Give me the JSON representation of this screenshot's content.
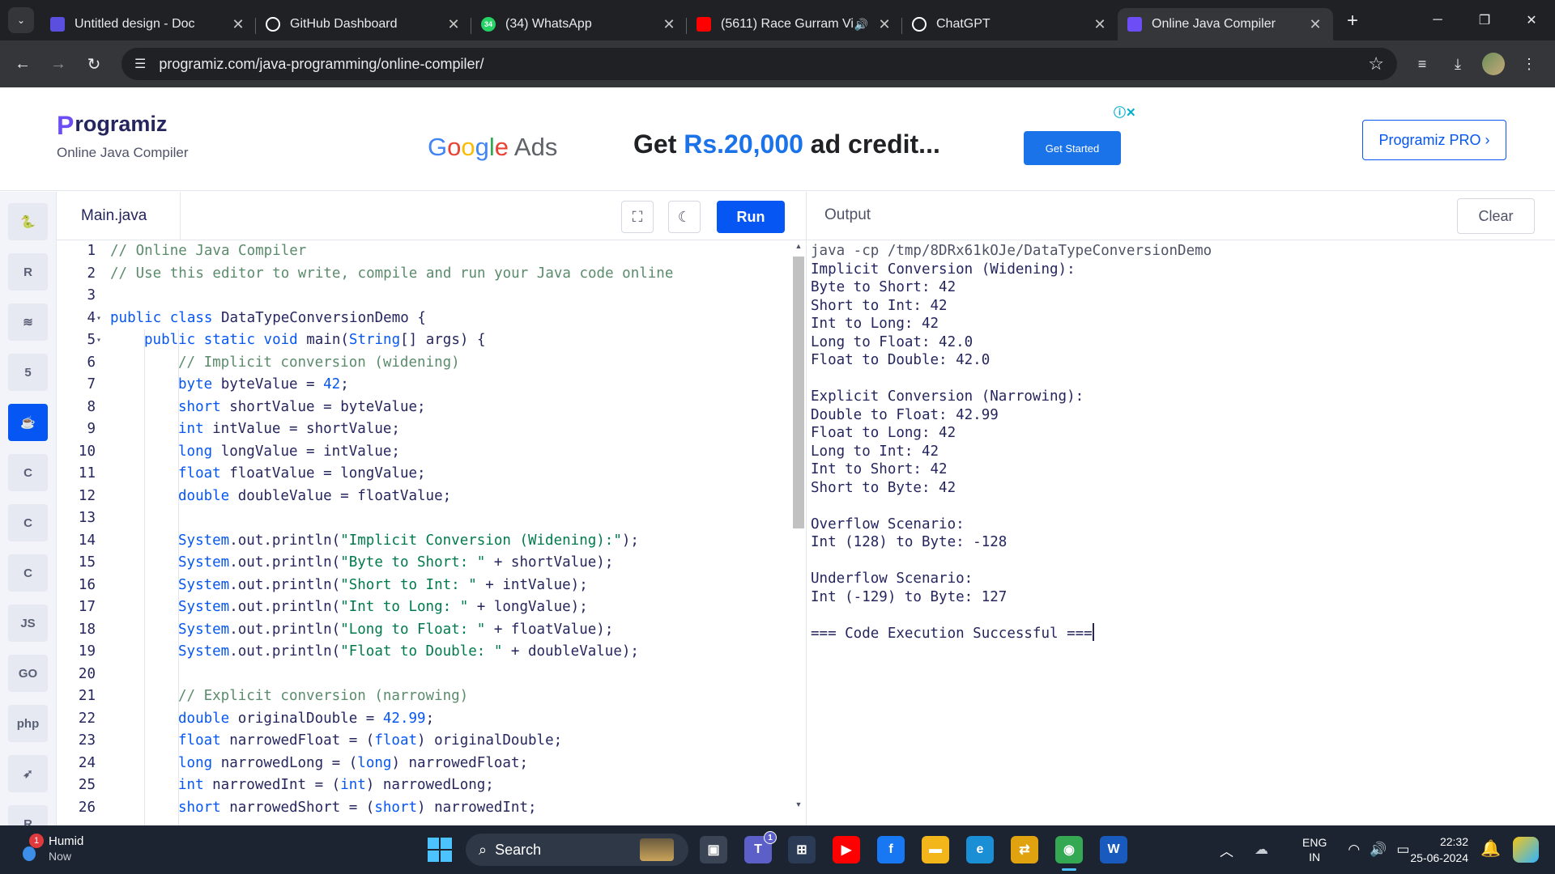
{
  "browser": {
    "tabs": [
      {
        "title": "Untitled design - Doc",
        "icon": "canva-docs-icon",
        "color": "#5b4fe0"
      },
      {
        "title": "GitHub Dashboard",
        "icon": "github-icon",
        "color": "#ffffff"
      },
      {
        "title": "(34) WhatsApp",
        "icon": "whatsapp-icon",
        "color": "#25d366",
        "badge": "34"
      },
      {
        "title": "(5611) Race Gurram Vi",
        "icon": "youtube-icon",
        "color": "#ff0000",
        "audio": true
      },
      {
        "title": "ChatGPT",
        "icon": "chatgpt-icon",
        "color": "#ffffff"
      },
      {
        "title": "Online Java Compiler",
        "icon": "programiz-icon",
        "color": "#6c4df6",
        "active": true
      }
    ],
    "url": "programiz.com/java-programming/online-compiler/"
  },
  "header": {
    "logo_text": "rogramiz",
    "logo_mark": "P",
    "subtitle": "Online Java Compiler",
    "pro_button": "Programiz PRO ›"
  },
  "ad": {
    "brand_google": [
      "G",
      "o",
      "o",
      "g",
      "l",
      "e"
    ],
    "brand_ads": " Ads",
    "headline_pre": "Get ",
    "headline_amount": "Rs.20,000",
    "headline_post": " ad credit...",
    "cta": "Get Started"
  },
  "sidebar": {
    "languages": [
      {
        "name": "python",
        "label": "🐍"
      },
      {
        "name": "r",
        "label": "R"
      },
      {
        "name": "sql",
        "label": "≋"
      },
      {
        "name": "html",
        "label": "5"
      },
      {
        "name": "java",
        "label": "☕",
        "active": true
      },
      {
        "name": "c",
        "label": "C"
      },
      {
        "name": "cpp",
        "label": "C"
      },
      {
        "name": "csharp",
        "label": "C"
      },
      {
        "name": "javascript",
        "label": "JS"
      },
      {
        "name": "go",
        "label": "GO"
      },
      {
        "name": "php",
        "label": "php"
      },
      {
        "name": "swift",
        "label": "➶"
      },
      {
        "name": "rust",
        "label": "R"
      }
    ]
  },
  "editor": {
    "filename": "Main.java",
    "run_label": "Run",
    "lines": [
      {
        "n": "1",
        "fold": "",
        "indent": 0,
        "tokens": [
          [
            "c",
            "// Online Java Compiler"
          ]
        ]
      },
      {
        "n": "2",
        "fold": "",
        "indent": 0,
        "tokens": [
          [
            "c",
            "// Use this editor to write, compile and run your Java code online"
          ]
        ]
      },
      {
        "n": "3",
        "fold": "",
        "indent": 0,
        "tokens": []
      },
      {
        "n": "4",
        "fold": "▾",
        "indent": 0,
        "tokens": [
          [
            "k",
            "public"
          ],
          [
            "t",
            " "
          ],
          [
            "k",
            "class"
          ],
          [
            "t",
            " DataTypeConversionDemo {"
          ]
        ]
      },
      {
        "n": "5",
        "fold": "▾",
        "indent": 1,
        "tokens": [
          [
            "k",
            "public"
          ],
          [
            "t",
            " "
          ],
          [
            "k",
            "static"
          ],
          [
            "t",
            " "
          ],
          [
            "k",
            "void"
          ],
          [
            "t",
            " main("
          ],
          [
            "k",
            "String"
          ],
          [
            "t",
            "[] args) {"
          ]
        ]
      },
      {
        "n": "6",
        "fold": "",
        "indent": 2,
        "tokens": [
          [
            "c",
            "// Implicit conversion (widening)"
          ]
        ]
      },
      {
        "n": "7",
        "fold": "",
        "indent": 2,
        "tokens": [
          [
            "k",
            "byte"
          ],
          [
            "t",
            " byteValue = "
          ],
          [
            "n",
            "42"
          ],
          [
            "t",
            ";"
          ]
        ]
      },
      {
        "n": "8",
        "fold": "",
        "indent": 2,
        "tokens": [
          [
            "k",
            "short"
          ],
          [
            "t",
            " shortValue = byteValue;"
          ]
        ]
      },
      {
        "n": "9",
        "fold": "",
        "indent": 2,
        "tokens": [
          [
            "k",
            "int"
          ],
          [
            "t",
            " intValue = shortValue;"
          ]
        ]
      },
      {
        "n": "10",
        "fold": "",
        "indent": 2,
        "tokens": [
          [
            "k",
            "long"
          ],
          [
            "t",
            " longValue = intValue;"
          ]
        ]
      },
      {
        "n": "11",
        "fold": "",
        "indent": 2,
        "tokens": [
          [
            "k",
            "float"
          ],
          [
            "t",
            " floatValue = longValue;"
          ]
        ]
      },
      {
        "n": "12",
        "fold": "",
        "indent": 2,
        "tokens": [
          [
            "k",
            "double"
          ],
          [
            "t",
            " doubleValue = floatValue;"
          ]
        ]
      },
      {
        "n": "13",
        "fold": "",
        "indent": 2,
        "tokens": []
      },
      {
        "n": "14",
        "fold": "",
        "indent": 2,
        "tokens": [
          [
            "k",
            "System"
          ],
          [
            "t",
            ".out.println("
          ],
          [
            "s",
            "\"Implicit Conversion (Widening):\""
          ],
          [
            "t",
            ");"
          ]
        ]
      },
      {
        "n": "15",
        "fold": "",
        "indent": 2,
        "tokens": [
          [
            "k",
            "System"
          ],
          [
            "t",
            ".out.println("
          ],
          [
            "s",
            "\"Byte to Short: \""
          ],
          [
            "t",
            " + shortValue);"
          ]
        ]
      },
      {
        "n": "16",
        "fold": "",
        "indent": 2,
        "tokens": [
          [
            "k",
            "System"
          ],
          [
            "t",
            ".out.println("
          ],
          [
            "s",
            "\"Short to Int: \""
          ],
          [
            "t",
            " + intValue);"
          ]
        ]
      },
      {
        "n": "17",
        "fold": "",
        "indent": 2,
        "tokens": [
          [
            "k",
            "System"
          ],
          [
            "t",
            ".out.println("
          ],
          [
            "s",
            "\"Int to Long: \""
          ],
          [
            "t",
            " + longValue);"
          ]
        ]
      },
      {
        "n": "18",
        "fold": "",
        "indent": 2,
        "tokens": [
          [
            "k",
            "System"
          ],
          [
            "t",
            ".out.println("
          ],
          [
            "s",
            "\"Long to Float: \""
          ],
          [
            "t",
            " + floatValue);"
          ]
        ]
      },
      {
        "n": "19",
        "fold": "",
        "indent": 2,
        "tokens": [
          [
            "k",
            "System"
          ],
          [
            "t",
            ".out.println("
          ],
          [
            "s",
            "\"Float to Double: \""
          ],
          [
            "t",
            " + doubleValue);"
          ]
        ]
      },
      {
        "n": "20",
        "fold": "",
        "indent": 2,
        "tokens": []
      },
      {
        "n": "21",
        "fold": "",
        "indent": 2,
        "tokens": [
          [
            "c",
            "// Explicit conversion (narrowing)"
          ]
        ]
      },
      {
        "n": "22",
        "fold": "",
        "indent": 2,
        "tokens": [
          [
            "k",
            "double"
          ],
          [
            "t",
            " originalDouble = "
          ],
          [
            "n",
            "42.99"
          ],
          [
            "t",
            ";"
          ]
        ]
      },
      {
        "n": "23",
        "fold": "",
        "indent": 2,
        "tokens": [
          [
            "k",
            "float"
          ],
          [
            "t",
            " narrowedFloat = ("
          ],
          [
            "k",
            "float"
          ],
          [
            "t",
            ") originalDouble;"
          ]
        ]
      },
      {
        "n": "24",
        "fold": "",
        "indent": 2,
        "tokens": [
          [
            "k",
            "long"
          ],
          [
            "t",
            " narrowedLong = ("
          ],
          [
            "k",
            "long"
          ],
          [
            "t",
            ") narrowedFloat;"
          ]
        ]
      },
      {
        "n": "25",
        "fold": "",
        "indent": 2,
        "tokens": [
          [
            "k",
            "int"
          ],
          [
            "t",
            " narrowedInt = ("
          ],
          [
            "k",
            "int"
          ],
          [
            "t",
            ") narrowedLong;"
          ]
        ]
      },
      {
        "n": "26",
        "fold": "",
        "indent": 2,
        "tokens": [
          [
            "k",
            "short"
          ],
          [
            "t",
            " narrowedShort = ("
          ],
          [
            "k",
            "short"
          ],
          [
            "t",
            ") narrowedInt;"
          ]
        ]
      }
    ]
  },
  "output": {
    "label": "Output",
    "clear_label": "Clear",
    "command": "java -cp /tmp/8DRx61kOJe/DataTypeConversionDemo",
    "lines": [
      "Implicit Conversion (Widening):",
      "Byte to Short: 42",
      "Short to Int: 42",
      "Int to Long: 42",
      "Long to Float: 42.0",
      "Float to Double: 42.0",
      "",
      "Explicit Conversion (Narrowing):",
      "Double to Float: 42.99",
      "Float to Long: 42",
      "Long to Int: 42",
      "Int to Short: 42",
      "Short to Byte: 42",
      "",
      "Overflow Scenario:",
      "Int (128) to Byte: -128",
      "",
      "Underflow Scenario:",
      "Int (-129) to Byte: 127",
      "",
      "=== Code Execution Successful ==="
    ]
  },
  "taskbar": {
    "weather_title": "Humid",
    "weather_sub": "Now",
    "weather_badge": "1",
    "search_label": "Search",
    "apps": [
      {
        "name": "task-view",
        "label": "▣",
        "color": "#3a4454"
      },
      {
        "name": "teams",
        "label": "T",
        "color": "#5b5fc7",
        "badge": "1"
      },
      {
        "name": "microsoft-store",
        "label": "⊞",
        "color": "#2b3a55"
      },
      {
        "name": "youtube",
        "label": "▶",
        "color": "#ff0000"
      },
      {
        "name": "facebook",
        "label": "f",
        "color": "#1877f2"
      },
      {
        "name": "file-explorer",
        "label": "▬",
        "color": "#f2b61b"
      },
      {
        "name": "edge",
        "label": "e",
        "color": "#1a8fd6"
      },
      {
        "name": "arrows-app",
        "label": "⇄",
        "color": "#e0a20e"
      },
      {
        "name": "chrome",
        "label": "◉",
        "color": "#34a853",
        "active": true
      },
      {
        "name": "word",
        "label": "W",
        "color": "#185abd"
      }
    ],
    "lang_line1": "ENG",
    "lang_line2": "IN",
    "time": "22:32",
    "date": "25-06-2024"
  }
}
